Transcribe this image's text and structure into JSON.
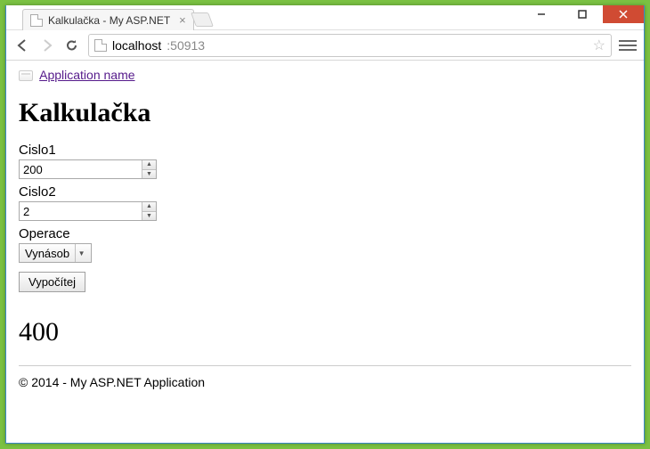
{
  "window": {
    "tab_title": "Kalkulačka - My ASP.NET",
    "url_host": "localhost",
    "url_path": ":50913"
  },
  "header": {
    "app_link": "Application name"
  },
  "page": {
    "title": "Kalkulačka",
    "cislo1_label": "Cislo1",
    "cislo1_value": "200",
    "cislo2_label": "Cislo2",
    "cislo2_value": "2",
    "operace_label": "Operace",
    "operace_selected": "Vynásob",
    "submit_label": "Vypočítej",
    "result": "400"
  },
  "footer": {
    "text": "© 2014 - My ASP.NET Application"
  }
}
